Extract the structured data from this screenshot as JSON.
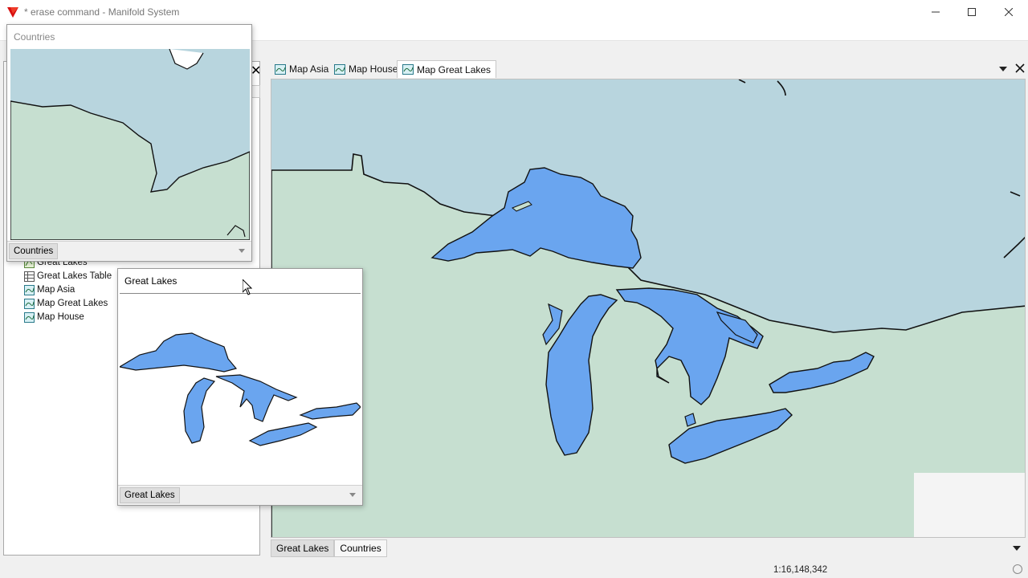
{
  "window": {
    "title": "* erase command - Manifold System",
    "icons": {
      "app": "manifold-logo-icon",
      "minimize": "minimize-icon",
      "maximize": "maximize-icon",
      "close": "close-icon"
    }
  },
  "project_tree": {
    "items": [
      {
        "label": "Great Lakes",
        "icon": "drawing-icon"
      },
      {
        "label": "Great Lakes Table",
        "icon": "table-icon"
      },
      {
        "label": "Map Asia",
        "icon": "map-icon"
      },
      {
        "label": "Map Great Lakes",
        "icon": "map-icon"
      },
      {
        "label": "Map House",
        "icon": "map-icon"
      }
    ]
  },
  "doc_tabs": [
    {
      "label": "Map Asia",
      "icon": "map-icon",
      "active": false
    },
    {
      "label": "Map House",
      "icon": "map-icon",
      "active": false
    },
    {
      "label": "Map Great Lakes",
      "icon": "map-icon",
      "active": true
    }
  ],
  "map_layer_tabs": [
    {
      "label": "Great Lakes",
      "active": true
    },
    {
      "label": "Countries",
      "active": false
    }
  ],
  "countries_window": {
    "title": "Countries",
    "footer_tab": "Countries"
  },
  "great_lakes_window": {
    "title": "Great Lakes",
    "footer_tab": "Great Lakes"
  },
  "status": {
    "scale": "1:16,148,342"
  },
  "colors": {
    "water": "#b8d5de",
    "land": "#c6dfd0",
    "lakes": "#6aa5ef",
    "accent": "#d81010"
  }
}
